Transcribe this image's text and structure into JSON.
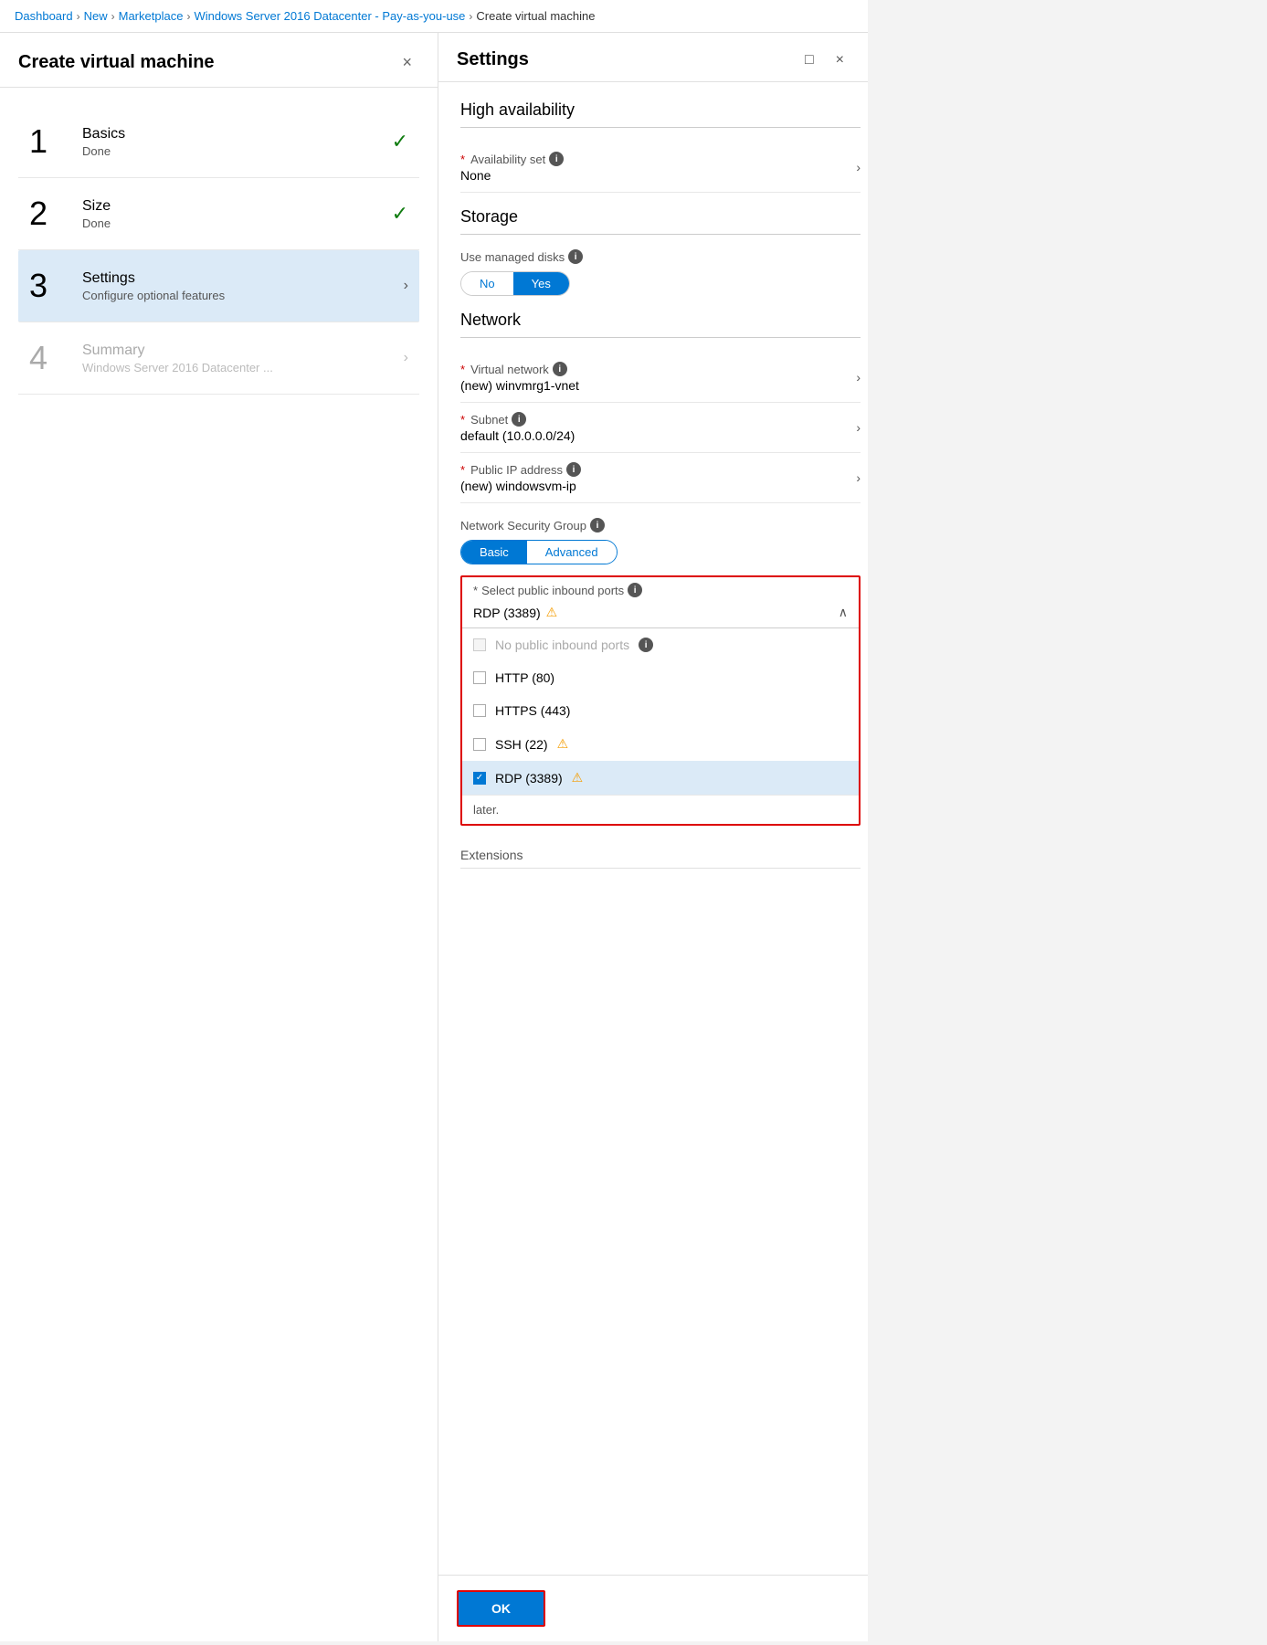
{
  "breadcrumb": {
    "items": [
      {
        "label": "Dashboard",
        "link": true
      },
      {
        "label": "New",
        "link": true
      },
      {
        "label": "Marketplace",
        "link": true
      },
      {
        "label": "Windows Server 2016 Datacenter - Pay-as-you-use",
        "link": true
      },
      {
        "label": "Create virtual machine",
        "link": false
      }
    ],
    "separators": [
      ">",
      ">",
      ">",
      ">"
    ]
  },
  "left_panel": {
    "title": "Create virtual machine",
    "close_label": "×",
    "steps": [
      {
        "number": "1",
        "name": "Basics",
        "sub": "Done",
        "status": "done",
        "active": false,
        "muted": false
      },
      {
        "number": "2",
        "name": "Size",
        "sub": "Done",
        "status": "done",
        "active": false,
        "muted": false
      },
      {
        "number": "3",
        "name": "Settings",
        "sub": "Configure optional features",
        "status": "active",
        "active": true,
        "muted": false
      },
      {
        "number": "4",
        "name": "Summary",
        "sub": "Windows Server 2016 Datacenter ...",
        "status": "pending",
        "active": false,
        "muted": true
      }
    ]
  },
  "right_panel": {
    "title": "Settings",
    "maximize_label": "□",
    "close_label": "×",
    "sections": {
      "high_availability": {
        "title": "High availability",
        "fields": [
          {
            "required": true,
            "label": "Availability set",
            "has_info": true,
            "value": "None"
          }
        ]
      },
      "storage": {
        "title": "Storage",
        "use_managed_disks_label": "Use managed disks",
        "has_info": true,
        "toggle": {
          "no_label": "No",
          "yes_label": "Yes",
          "selected": "yes"
        }
      },
      "network": {
        "title": "Network",
        "fields": [
          {
            "required": true,
            "label": "Virtual network",
            "has_info": true,
            "value": "(new) winvmrg1-vnet"
          },
          {
            "required": true,
            "label": "Subnet",
            "has_info": true,
            "value": "default (10.0.0.0/24)"
          },
          {
            "required": true,
            "label": "Public IP address",
            "has_info": true,
            "value": "(new) windowsvm-ip"
          }
        ],
        "nsg": {
          "label": "Network Security Group",
          "has_info": true,
          "buttons": [
            {
              "label": "Basic",
              "active": true
            },
            {
              "label": "Advanced",
              "active": false
            }
          ]
        }
      },
      "dropdown": {
        "label": "* Select public inbound ports",
        "has_info": true,
        "selected_value": "RDP (3389)",
        "has_warning": true,
        "items": [
          {
            "label": "No public inbound ports",
            "has_info": true,
            "checked": false,
            "disabled": true
          },
          {
            "label": "HTTP (80)",
            "checked": false,
            "disabled": false
          },
          {
            "label": "HTTPS (443)",
            "checked": false,
            "disabled": false
          },
          {
            "label": "SSH (22)",
            "checked": false,
            "has_warning": true,
            "disabled": false
          },
          {
            "label": "RDP (3389)",
            "checked": true,
            "has_warning": true,
            "disabled": false,
            "selected": true
          }
        ],
        "footer_text": "later."
      },
      "extensions": {
        "label": "Extensions"
      }
    },
    "ok_button_label": "OK"
  }
}
